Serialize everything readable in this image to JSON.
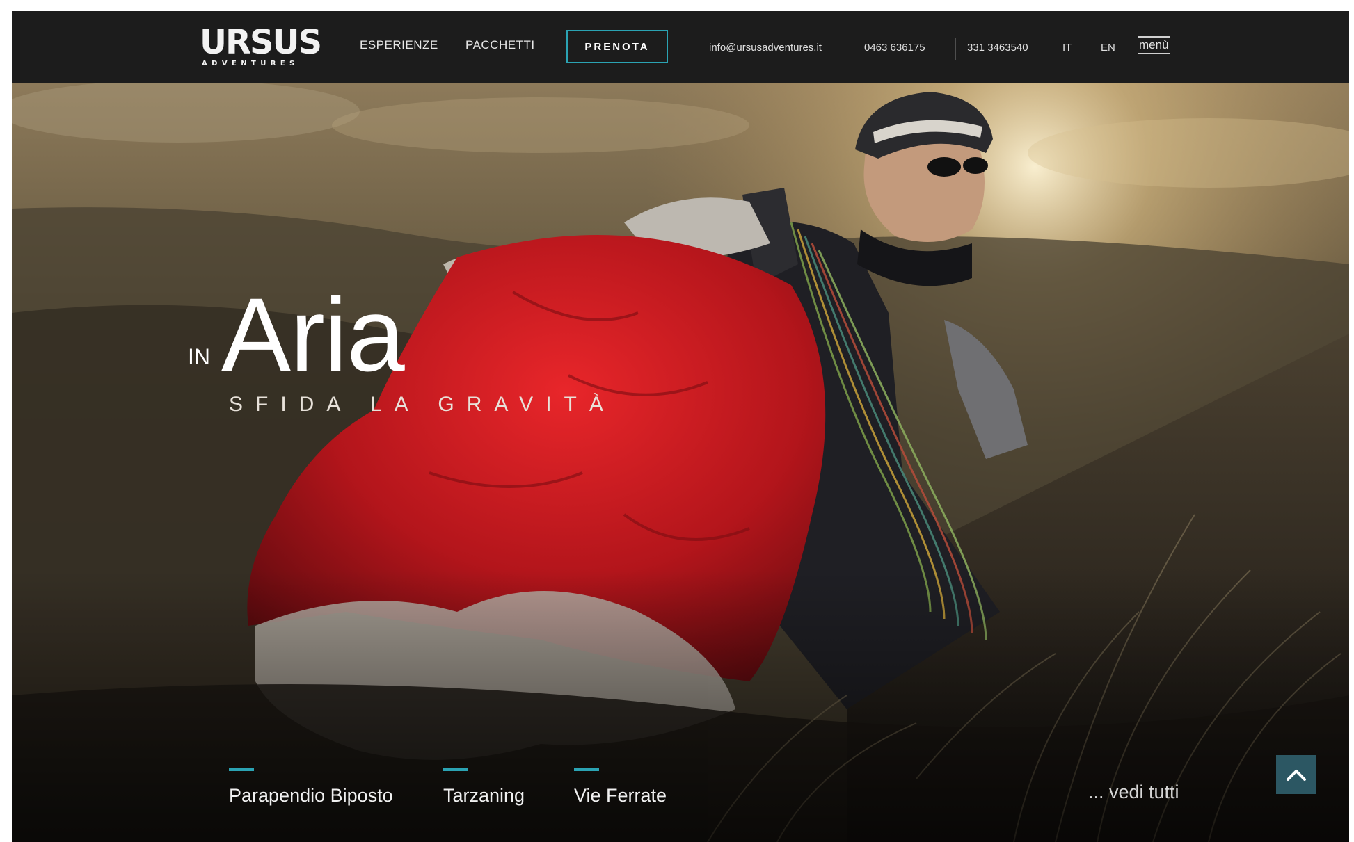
{
  "header": {
    "logo_text": "URSUS",
    "logo_subtext": "ADVENTURES",
    "nav": [
      {
        "label": "ESPERIENZE"
      },
      {
        "label": "PACCHETTI"
      }
    ],
    "cta_label": "PRENOTA",
    "email": "info@ursusadventures.it",
    "phone_1": "0463 636175",
    "phone_2": "331 3463540",
    "languages": [
      "IT",
      "EN"
    ],
    "menu_label": "menù"
  },
  "hero": {
    "title_prefix": "IN",
    "title": "Aria",
    "subtitle": "SFIDA LA GRAVITÀ",
    "experiences": [
      {
        "label": "Parapendio Biposto"
      },
      {
        "label": "Tarzaning"
      },
      {
        "label": "Vie Ferrate"
      }
    ],
    "see_all_label": "... vedi tutti"
  },
  "colors": {
    "accent": "#2ba3b3",
    "header_bg": "#1c1c1c",
    "scroll_button": "#2c5763"
  },
  "icons": {
    "scroll_top": "chevron-up-icon"
  }
}
